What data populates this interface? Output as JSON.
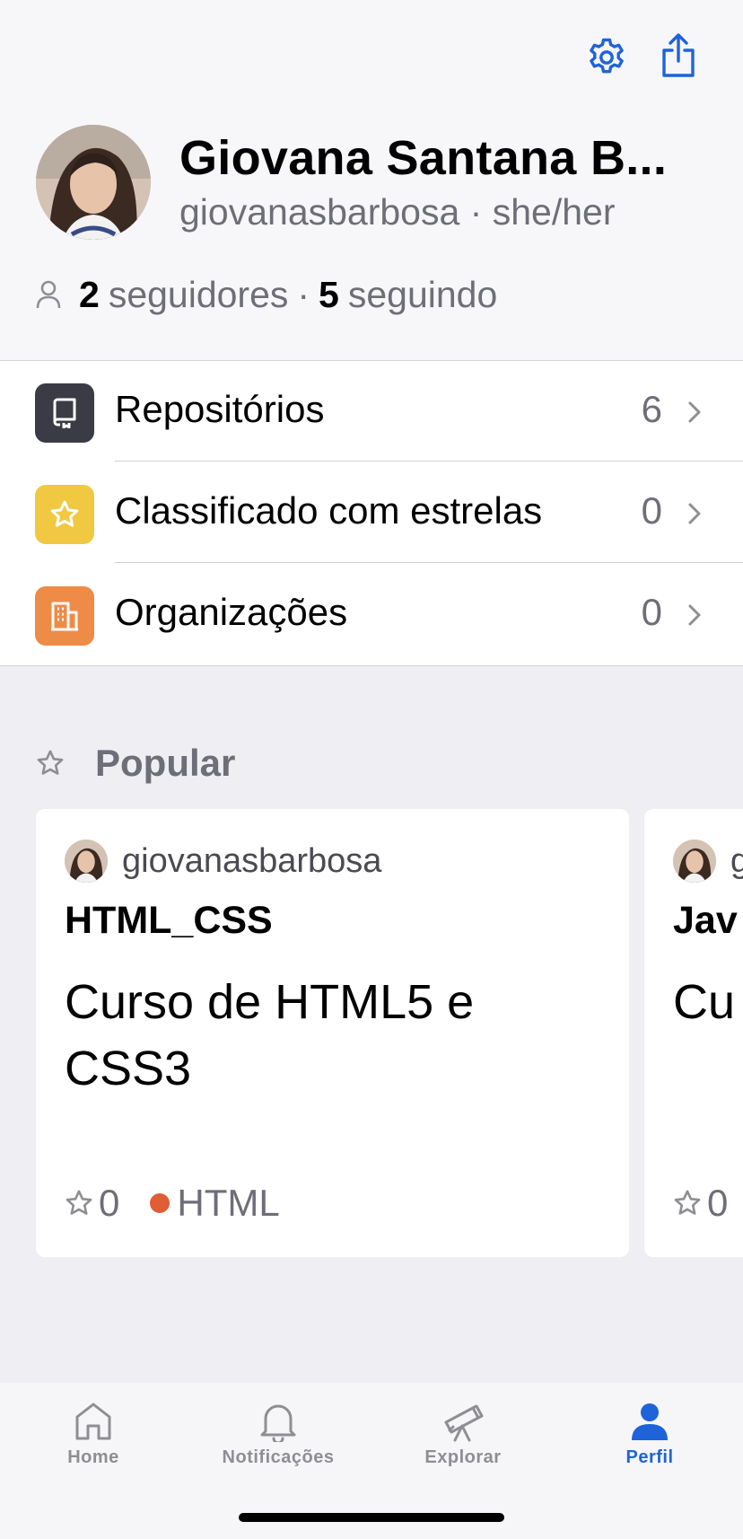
{
  "header": {
    "settings_icon": "gear-icon",
    "share_icon": "share-icon"
  },
  "profile": {
    "display_name": "Giovana Santana B...",
    "handle_line": "giovanasbarbosa · she/her",
    "followers_count": "2",
    "followers_label": "seguidores",
    "separator": "·",
    "following_count": "5",
    "following_label": "seguindo"
  },
  "menu": {
    "items": [
      {
        "label": "Repositórios",
        "count": "6",
        "icon": "repo-icon",
        "color": "#3a3b45"
      },
      {
        "label": "Classificado com estrelas",
        "count": "0",
        "icon": "star-icon",
        "color": "#f1c842"
      },
      {
        "label": "Organizações",
        "count": "0",
        "icon": "organization-icon",
        "color": "#ee8b47"
      }
    ]
  },
  "popular": {
    "title": "Popular",
    "cards": [
      {
        "owner": "giovanasbarbosa",
        "repo": "HTML_CSS",
        "description": "Curso de HTML5 e CSS3",
        "stars": "0",
        "language": "HTML",
        "language_color": "#e05d35"
      },
      {
        "owner": "g",
        "repo": "Jav",
        "description": "Cu",
        "stars": "0",
        "language": "",
        "language_color": ""
      }
    ]
  },
  "tabbar": {
    "tabs": [
      {
        "label": "Home",
        "icon": "home-icon"
      },
      {
        "label": "Notificações",
        "icon": "bell-icon"
      },
      {
        "label": "Explorar",
        "icon": "telescope-icon"
      },
      {
        "label": "Perfil",
        "icon": "person-icon",
        "active": true
      }
    ],
    "active_color": "#1f63d8"
  }
}
